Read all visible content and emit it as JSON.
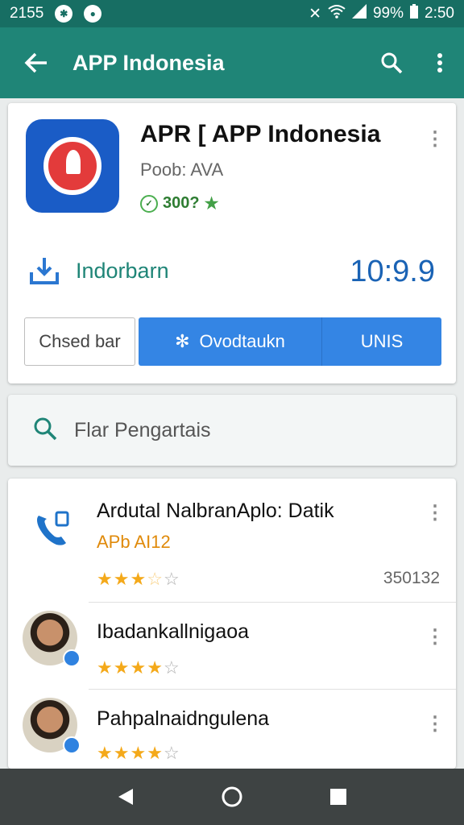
{
  "status_bar": {
    "left_text": "2155",
    "battery": "99%",
    "time": "2:50"
  },
  "app_bar": {
    "title": "APP Indonesia"
  },
  "app_card": {
    "name": "APR [ APP Indonesia",
    "developer": "Poob: AVA",
    "rating": "300?",
    "install_label": "Indorbarn",
    "install_count": "10:9.9",
    "secondary_button": "Chsed bar",
    "primary_button": "Ovodtaukn",
    "primary_button_right": "UNIS"
  },
  "search": {
    "text": "Flar Pengartais"
  },
  "list": [
    {
      "title": "Ardutal NalbranAplo: Datik",
      "subtitle": "APb AI12",
      "rating": 3.5,
      "count": "350132",
      "icon": "phone-icon"
    },
    {
      "title": "Ibadankallnigaoa",
      "rating": 4,
      "icon": "avatar"
    },
    {
      "title": "Pahpalnaidngulena",
      "rating": 4,
      "icon": "avatar"
    }
  ],
  "colors": {
    "status_bar": "#176e63",
    "app_bar": "#1f8577",
    "primary_button": "#3485e4",
    "install_count": "#1a63b5",
    "star": "#f4a91a",
    "nav_bar": "#3e4343"
  }
}
